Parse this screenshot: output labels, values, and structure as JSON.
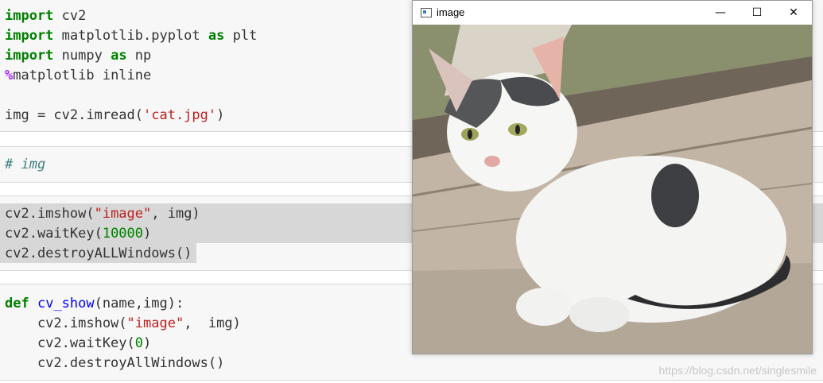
{
  "cell1": {
    "lines": [
      "import cv2",
      "import matplotlib.pyplot as plt",
      "import numpy as np",
      "%matplotlib inline",
      "",
      "img = cv2.imread('cat.jpg')"
    ]
  },
  "cell2": {
    "comment": "# img"
  },
  "cell3": {
    "line1_fn": "cv2.imshow(",
    "line1_str": "\"image\"",
    "line1_rest": ", img)",
    "line2_fn": "cv2.waitKey(",
    "line2_num": "10000",
    "line2_rest": ")",
    "line3": "cv2.destroyALLWindows()"
  },
  "cell4": {
    "def_kw": "def",
    "def_name": "cv_show",
    "def_args": "(name,img):",
    "l2_fn": "    cv2.imshow(",
    "l2_str": "\"image\"",
    "l2_rest": ",  img)",
    "l3_fn": "    cv2.waitKey(",
    "l3_num": "0",
    "l3_rest": ")",
    "l4": "    cv2.destroyAllWindows()"
  },
  "window": {
    "title": "image",
    "minimize": "—",
    "maximize": "☐",
    "close": "✕"
  },
  "watermark": "https://blog.csdn.net/singlesmile"
}
